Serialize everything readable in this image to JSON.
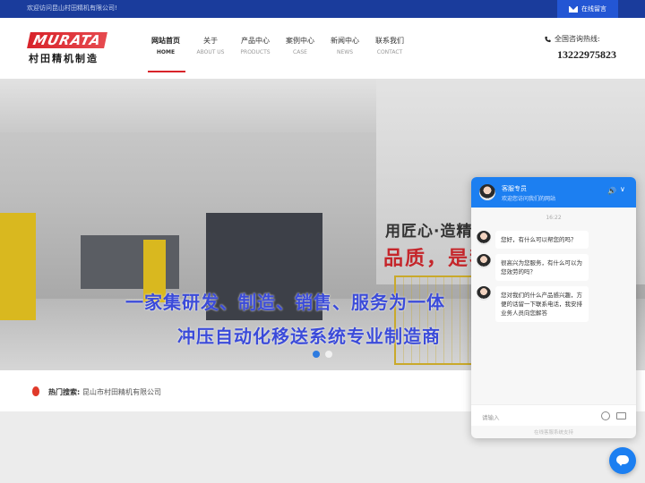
{
  "topbar": {
    "welcome": "欢迎访问昆山村田精机有限公司!",
    "message_button": "在线留言"
  },
  "logo": {
    "mark": "MURATA",
    "name": "村田精机制造"
  },
  "nav": {
    "items": [
      {
        "cn": "网站首页",
        "en": "HOME"
      },
      {
        "cn": "关于",
        "en": "ABOUT US"
      },
      {
        "cn": "产品中心",
        "en": "PRODUCTS"
      },
      {
        "cn": "案例中心",
        "en": "CASE"
      },
      {
        "cn": "新闻中心",
        "en": "NEWS"
      },
      {
        "cn": "联系我们",
        "en": "CONTACT"
      }
    ]
  },
  "hotline": {
    "label": "全国咨询热线:",
    "number": "13222975823"
  },
  "banner": {
    "slogan_small": "用匠心·造精品",
    "slogan_red": "品质，是我们不懈的追求",
    "slogan_line1": "一家集研发、制造、销售、服务为一体",
    "slogan_line2": "冲压自动化移送系统专业制造商"
  },
  "hot_search": {
    "label": "热门搜索:",
    "keyword": "昆山市村田精机有限公司"
  },
  "chat": {
    "agent_name": "客服专员",
    "agent_subtitle": "欢迎您访问我们的网站",
    "time": "16:22",
    "messages": [
      "您好，有什么可以帮您的吗？",
      "很高兴为您服务，有什么可以为您效劳的吗？",
      "您对我们的什么产品感兴趣，方便的话留一下联系电话，我安排业务人员向您解答"
    ],
    "input_placeholder": "请输入",
    "powered_by": "在线客服系统支持"
  },
  "icons": {
    "mail": "mail-icon",
    "phone": "phone-icon",
    "fire": "fire-icon",
    "sound": "sound-icon",
    "minimize": "chevron-down-icon",
    "emoji": "emoji-icon",
    "folder": "folder-icon",
    "chat_fab": "chat-bubble-icon"
  },
  "colors": {
    "topbar": "#1a3c9c",
    "accent_red": "#d8232a",
    "chat_blue": "#1c7ff1",
    "slogan_blue": "#3b4bd9"
  }
}
